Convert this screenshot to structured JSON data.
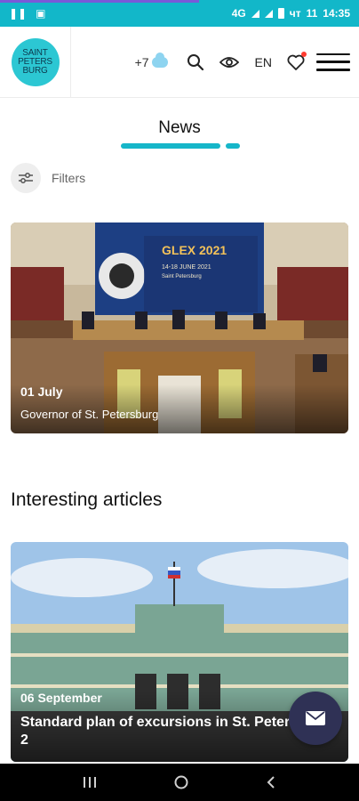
{
  "status_bar": {
    "network": "4G",
    "day": "чт",
    "date_num": "11",
    "time": "14:35"
  },
  "header": {
    "logo_lines": [
      "SAINT",
      "PETERS",
      "BURG"
    ],
    "temperature": "+7",
    "language": "EN",
    "icons": [
      "cloud-icon",
      "search-icon",
      "eye-icon",
      "heart-icon",
      "menu-icon"
    ]
  },
  "news": {
    "title": "News"
  },
  "filters": {
    "label": "Filters"
  },
  "news_card": {
    "date": "01 July",
    "caption": "Governor of St. Petersburg",
    "poster_title": "GLEX 2021",
    "poster_dates": "14-18 JUNE 2021",
    "poster_city": "Saint Petersburg"
  },
  "articles": {
    "title": "Interesting articles",
    "card": {
      "date": "06 September",
      "caption_line1": "Standard plan of excursions in St. Peters",
      "caption_line2": "2"
    }
  },
  "colors": {
    "accent": "#16b6c9",
    "fab": "#2f3155",
    "status_bar": "#12b7c9"
  }
}
